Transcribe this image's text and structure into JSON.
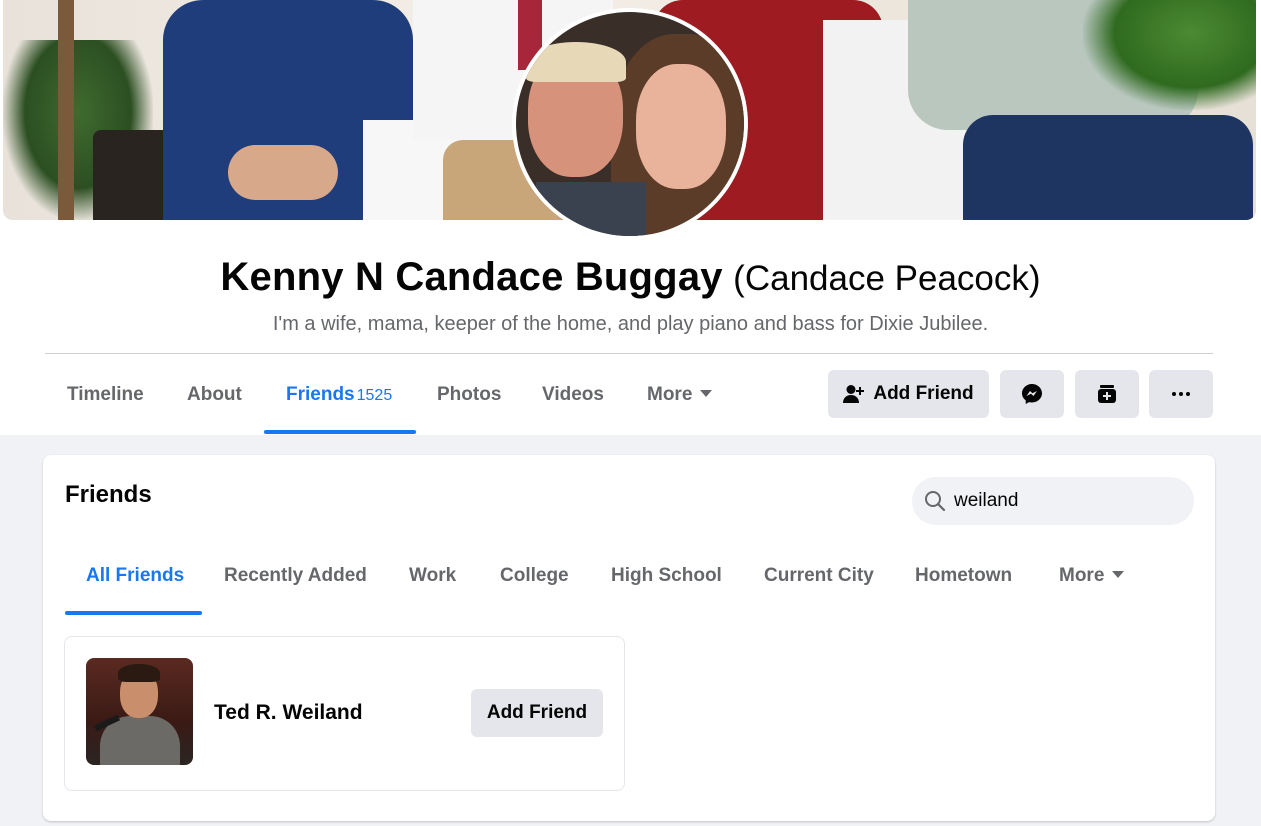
{
  "profile": {
    "name": "Kenny N Candace Buggay",
    "alternate_name": "(Candace Peacock)",
    "bio": "I'm a wife, mama, keeper of the home, and play piano and bass for Dixie Jubilee."
  },
  "profile_tabs": {
    "timeline": "Timeline",
    "about": "About",
    "friends": "Friends",
    "friends_count": "1525",
    "photos": "Photos",
    "videos": "Videos",
    "more": "More"
  },
  "actions": {
    "add_friend": "Add Friend",
    "icons": [
      "person-add-icon",
      "messenger-icon",
      "card-plus-icon",
      "more-dots-icon"
    ]
  },
  "friends_section": {
    "title": "Friends",
    "search": {
      "value": "weiland",
      "placeholder": "Search"
    },
    "tabs": {
      "all_friends": "All Friends",
      "recently_added": "Recently Added",
      "work": "Work",
      "college": "College",
      "high_school": "High School",
      "current_city": "Current City",
      "hometown": "Hometown",
      "more": "More"
    },
    "results": [
      {
        "name": "Ted R. Weiland",
        "action": "Add Friend"
      }
    ]
  },
  "colors": {
    "accent": "#1877f2",
    "secondary_text": "#65676b",
    "button_bg": "#e4e6eb",
    "page_bg": "#f0f2f5"
  }
}
